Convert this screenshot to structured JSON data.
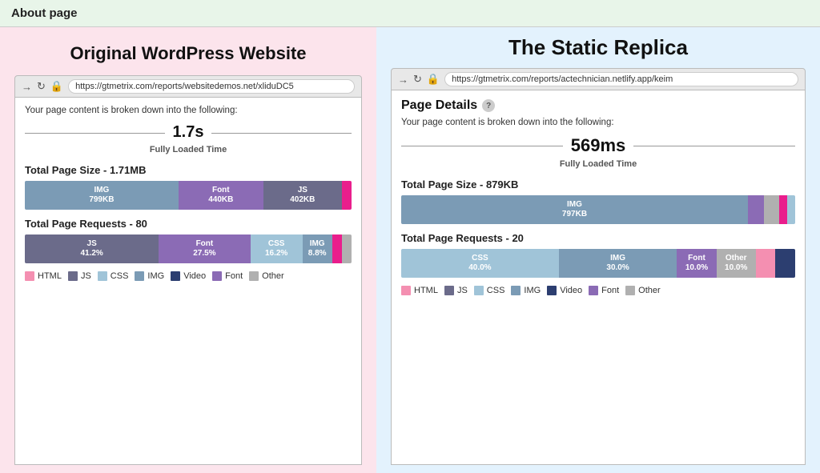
{
  "topBar": {
    "label": "About  page"
  },
  "leftPanel": {
    "title": "Original WordPress Website",
    "browserUrl": "https://gtmetrix.com/reports/websitedemos.net/xliduDC5",
    "introText": "Your page content is broken down into the following:",
    "loadedTime": "1.7s",
    "loadedLabel": "Fully Loaded Time",
    "pageSizeTitle": "Total Page Size - 1.71MB",
    "pageSizeSegments": [
      {
        "label": "IMG",
        "value": "799KB",
        "color": "img",
        "flex": 47
      },
      {
        "label": "Font",
        "value": "440KB",
        "color": "font",
        "flex": 26
      },
      {
        "label": "JS",
        "value": "402KB",
        "color": "js",
        "flex": 24
      },
      {
        "label": "",
        "value": "",
        "color": "pink-accent",
        "flex": 3
      }
    ],
    "pageRequestsTitle": "Total Page Requests - 80",
    "pageRequestsSegments": [
      {
        "label": "JS",
        "value": "41.2%",
        "color": "js",
        "flex": 41
      },
      {
        "label": "Font",
        "value": "27.5%",
        "color": "font",
        "flex": 28
      },
      {
        "label": "CSS",
        "value": "16.2%",
        "color": "css",
        "flex": 16
      },
      {
        "label": "IMG",
        "value": "8.8%",
        "color": "img",
        "flex": 9
      },
      {
        "label": "",
        "value": "",
        "color": "pink-accent",
        "flex": 3
      },
      {
        "label": "",
        "value": "",
        "color": "other",
        "flex": 3
      }
    ],
    "legend": [
      {
        "label": "HTML",
        "color": "html"
      },
      {
        "label": "JS",
        "color": "js"
      },
      {
        "label": "CSS",
        "color": "css"
      },
      {
        "label": "IMG",
        "color": "img"
      },
      {
        "label": "Video",
        "color": "video"
      },
      {
        "label": "Font",
        "color": "font"
      },
      {
        "label": "Other",
        "color": "other"
      }
    ]
  },
  "rightPanel": {
    "heading": "The Static Replica",
    "browserUrl": "https://gtmetrix.com/reports/actechnician.netlify.app/keim",
    "pageDetailsHeading": "Page Details",
    "pageDetailsHelp": "?",
    "introText": "Your page content is broken down into the following:",
    "loadedTime": "569ms",
    "loadedLabel": "Fully Loaded Time",
    "pageSizeTitle": "Total Page Size - 879KB",
    "pageSizeSegments": [
      {
        "label": "IMG",
        "value": "797KB",
        "color": "img",
        "flex": 88
      },
      {
        "label": "",
        "value": "",
        "color": "font",
        "flex": 4
      },
      {
        "label": "",
        "value": "",
        "color": "other",
        "flex": 4
      },
      {
        "label": "",
        "value": "",
        "color": "pink-accent",
        "flex": 2
      },
      {
        "label": "",
        "value": "",
        "color": "css",
        "flex": 2
      }
    ],
    "pageRequestsTitle": "Total Page Requests - 20",
    "pageRequestsSegments": [
      {
        "label": "CSS",
        "value": "40.0%",
        "color": "css",
        "flex": 40
      },
      {
        "label": "IMG",
        "value": "30.0%",
        "color": "img",
        "flex": 30
      },
      {
        "label": "Font",
        "value": "10.0%",
        "color": "font",
        "flex": 10
      },
      {
        "label": "Other",
        "value": "10.0%",
        "color": "other",
        "flex": 10
      },
      {
        "label": "",
        "value": "",
        "color": "html",
        "flex": 5
      },
      {
        "label": "",
        "value": "",
        "color": "video",
        "flex": 5
      }
    ],
    "legend": [
      {
        "label": "HTML",
        "color": "html"
      },
      {
        "label": "JS",
        "color": "js"
      },
      {
        "label": "CSS",
        "color": "css"
      },
      {
        "label": "IMG",
        "color": "img"
      },
      {
        "label": "Video",
        "color": "video"
      },
      {
        "label": "Font",
        "color": "font"
      },
      {
        "label": "Other",
        "color": "other"
      }
    ]
  }
}
